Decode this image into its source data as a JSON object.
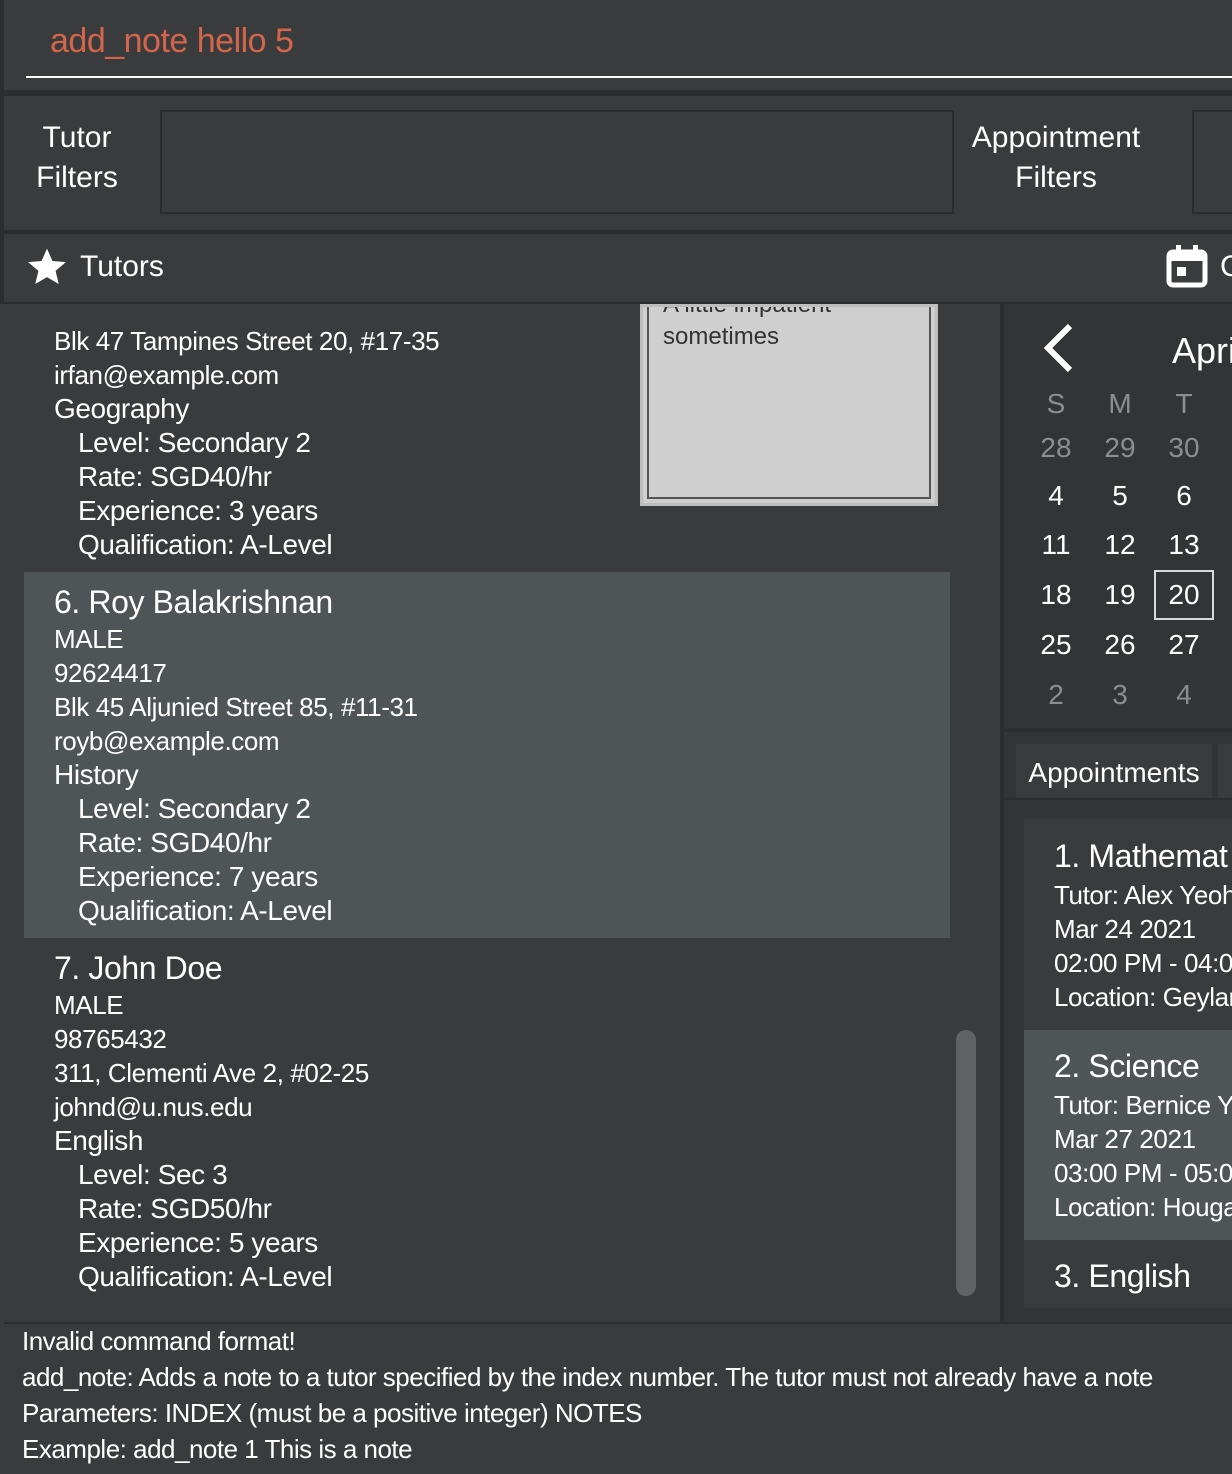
{
  "command": {
    "input": "add_note hello 5"
  },
  "filters": {
    "tutor_label_1": "Tutor",
    "tutor_label_2": "Filters",
    "appointment_label_1": "Appointment",
    "appointment_label_2": "Filters"
  },
  "header": {
    "tutors_title": "Tutors",
    "calendar_title_partial": "C"
  },
  "tutors": {
    "partial": {
      "address": "Blk 47 Tampines Street 20, #17-35",
      "email": "irfan@example.com",
      "subject": "Geography",
      "level": "Level: Secondary 2",
      "rate": "Rate: SGD40/hr",
      "experience": "Experience: 3 years",
      "qualification": "Qualification: A-Level",
      "note_line_1": "A little impatient",
      "note_line_2": "sometimes"
    },
    "t6": {
      "name": "6.  Roy Balakrishnan",
      "gender": "MALE",
      "phone": "92624417",
      "address": "Blk 45 Aljunied Street 85, #11-31",
      "email": "royb@example.com",
      "subject": "History",
      "level": "Level: Secondary 2",
      "rate": "Rate: SGD40/hr",
      "experience": "Experience: 7 years",
      "qualification": "Qualification: A-Level"
    },
    "t7": {
      "name": "7.  John Doe",
      "gender": "MALE",
      "phone": "98765432",
      "address": "311, Clementi Ave 2, #02-25",
      "email": "johnd@u.nus.edu",
      "subject": "English",
      "level": "Level: Sec 3",
      "rate": "Rate: SGD50/hr",
      "experience": "Experience: 5 years",
      "qualification": "Qualification: A-Level"
    }
  },
  "calendar": {
    "month_partial": "Apri",
    "weekdays": [
      "S",
      "M",
      "T"
    ],
    "rows": [
      [
        "28",
        "29",
        "30"
      ],
      [
        "4",
        "5",
        "6"
      ],
      [
        "11",
        "12",
        "13"
      ],
      [
        "18",
        "19",
        "20"
      ],
      [
        "25",
        "26",
        "27"
      ],
      [
        "2",
        "3",
        "4"
      ]
    ],
    "selected": "20"
  },
  "appointments": {
    "tab_label": "Appointments",
    "a1": {
      "title": "1.  Mathemat",
      "tutor": "Tutor: Alex Yeoh",
      "date": "Mar 24 2021",
      "time": "02:00 PM - 04:0",
      "location": "Location: Geylan"
    },
    "a2": {
      "title": "2.  Science",
      "tutor": "Tutor: Bernice Yu",
      "date": "Mar 27 2021",
      "time": "03:00 PM - 05:0",
      "location": "Location: Houga"
    },
    "a3": {
      "title": "3.  English"
    }
  },
  "result": {
    "line1": "Invalid command format!",
    "line2": "add_note: Adds a note to a tutor specified by the index number. The tutor must not already have a note",
    "line3": "Parameters: INDEX (must be a positive integer) NOTES",
    "line4": "Example: add_note 1 This is a note"
  },
  "colors": {
    "background": "#3a3b3d",
    "selected_card": "#4f5557",
    "command_text": "#d3654b",
    "note_background": "#cfcfcf"
  }
}
